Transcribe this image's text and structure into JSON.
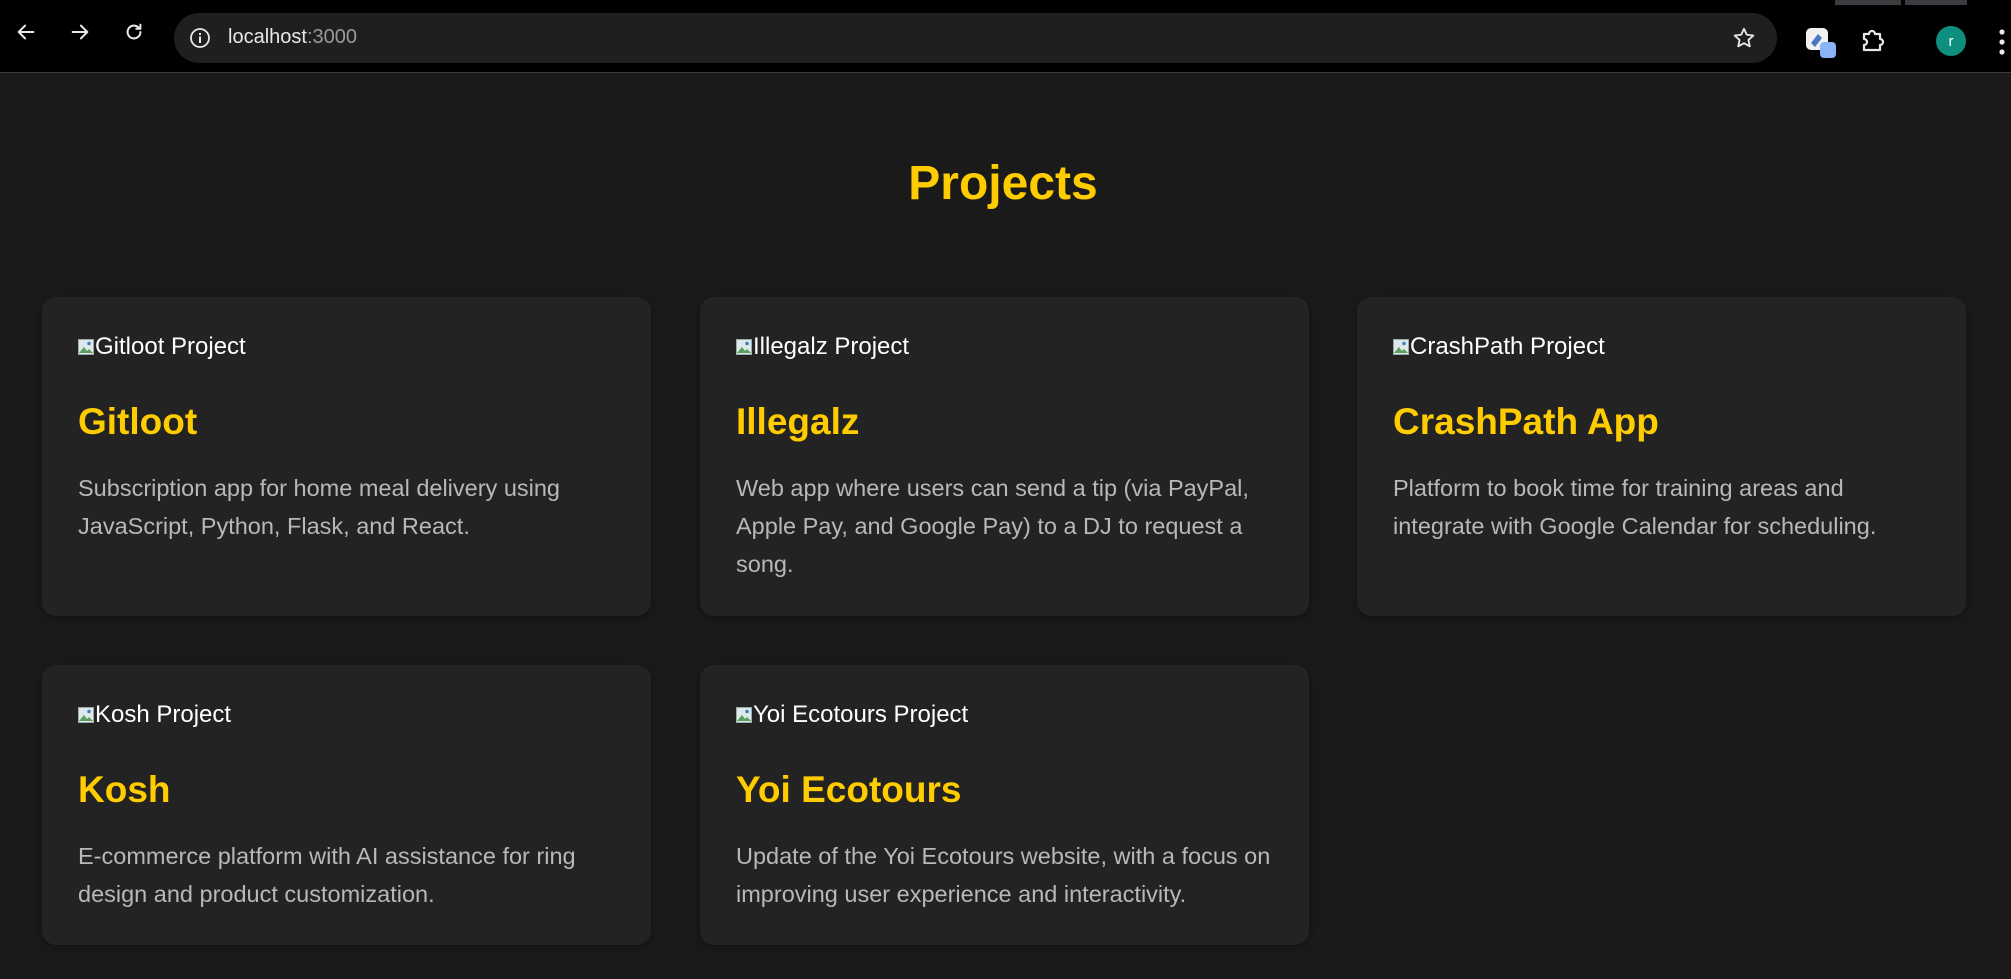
{
  "browser": {
    "url_host": "localhost",
    "url_port": ":3000",
    "profile_initial": "r",
    "colors": {
      "chrome_bg": "#000000",
      "omnibox_bg": "#1f1f1f",
      "avatar_bg": "#0e8f7e"
    },
    "icons": [
      "back-arrow-icon",
      "forward-arrow-icon",
      "reload-icon",
      "site-info-icon",
      "bookmark-star-icon",
      "extension-icon",
      "puzzle-extensions-icon",
      "kebab-menu-icon"
    ]
  },
  "page": {
    "title": "Projects",
    "colors": {
      "background": "#1a1a1a",
      "card_bg": "#232323",
      "accent": "#ffcc00",
      "text_muted": "#b8b8b8"
    },
    "projects": [
      {
        "img_alt": "Gitloot Project",
        "title": "Gitloot",
        "description": "Subscription app for home meal delivery using JavaScript, Python, Flask, and React."
      },
      {
        "img_alt": "Illegalz Project",
        "title": "Illegalz",
        "description": "Web app where users can send a tip (via PayPal, Apple Pay, and Google Pay) to a DJ to request a song."
      },
      {
        "img_alt": "CrashPath Project",
        "title": "CrashPath App",
        "description": "Platform to book time for training areas and integrate with Google Calendar for scheduling."
      },
      {
        "img_alt": "Kosh Project",
        "title": "Kosh",
        "description": "E-commerce platform with AI assistance for ring design and product customization."
      },
      {
        "img_alt": "Yoi Ecotours Project",
        "title": "Yoi Ecotours",
        "description": "Update of the Yoi Ecotours website, with a focus on improving user experience and interactivity."
      }
    ]
  }
}
